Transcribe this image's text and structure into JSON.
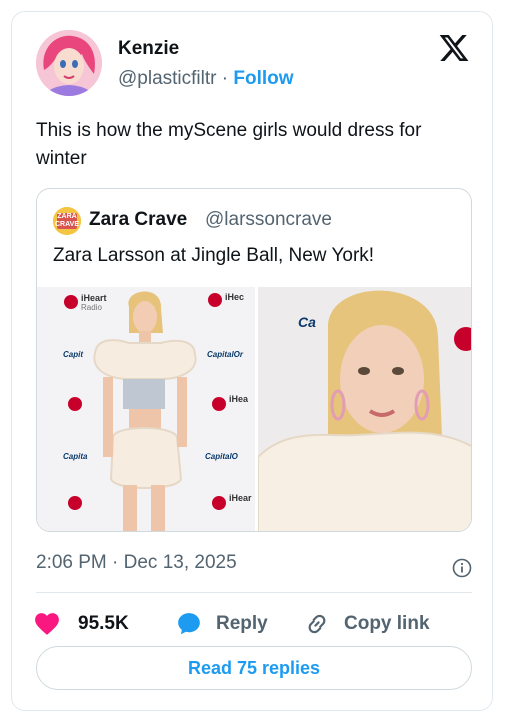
{
  "author": {
    "name": "Kenzie",
    "handle": "@plasticfiltr",
    "separator": "·",
    "follow_label": "Follow"
  },
  "tweet": {
    "text": "This is how the myScene girls would dress for winter"
  },
  "quoted": {
    "avatar_text": "ZARA CRAVE",
    "name": "Zara Crave",
    "handle": "@larssoncrave",
    "text": "Zara Larsson at Jingle Ball, New York!"
  },
  "photo_backdrop_text": {
    "iheart": "iHeart",
    "radio": "Radio",
    "capital": "Capital"
  },
  "meta": {
    "timestamp": "2:06 PM · Dec 13, 2025"
  },
  "actions": {
    "like_count": "95.5K",
    "reply_label": "Reply",
    "copy_link_label": "Copy link"
  },
  "read_replies_label": "Read 75 replies",
  "colors": {
    "accent": "#1d9bf0",
    "like": "#f91880",
    "muted_text": "#536471",
    "border": "#cfd9de"
  }
}
